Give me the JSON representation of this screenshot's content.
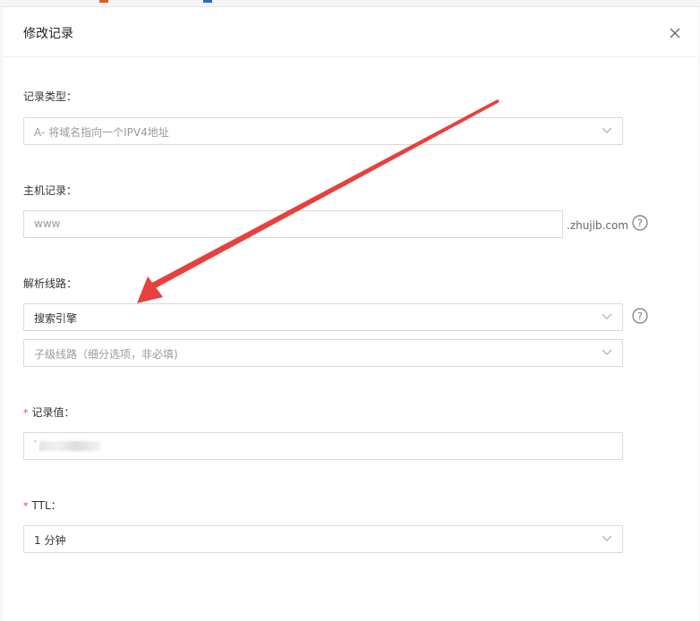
{
  "dialog": {
    "title": "修改记录",
    "close_icon": "close-icon"
  },
  "form": {
    "record_type": {
      "label": "记录类型：",
      "value": "A- 将域名指向一个IPV4地址"
    },
    "host_record": {
      "label": "主机记录：",
      "value": "www",
      "suffix": ".zhujib.com"
    },
    "line": {
      "label": "解析线路：",
      "value": "搜索引擎",
      "sub_placeholder": "子级线路（细分选项，非必填)"
    },
    "record_value": {
      "label": "记录值：",
      "required_mark": "*",
      "value": "`."
    },
    "ttl": {
      "label": "TTL：",
      "required_mark": "*",
      "value": "1 分钟"
    }
  },
  "colors": {
    "arrow": "#e8403d",
    "required": "#e8403d",
    "border": "#d9d9d9"
  }
}
